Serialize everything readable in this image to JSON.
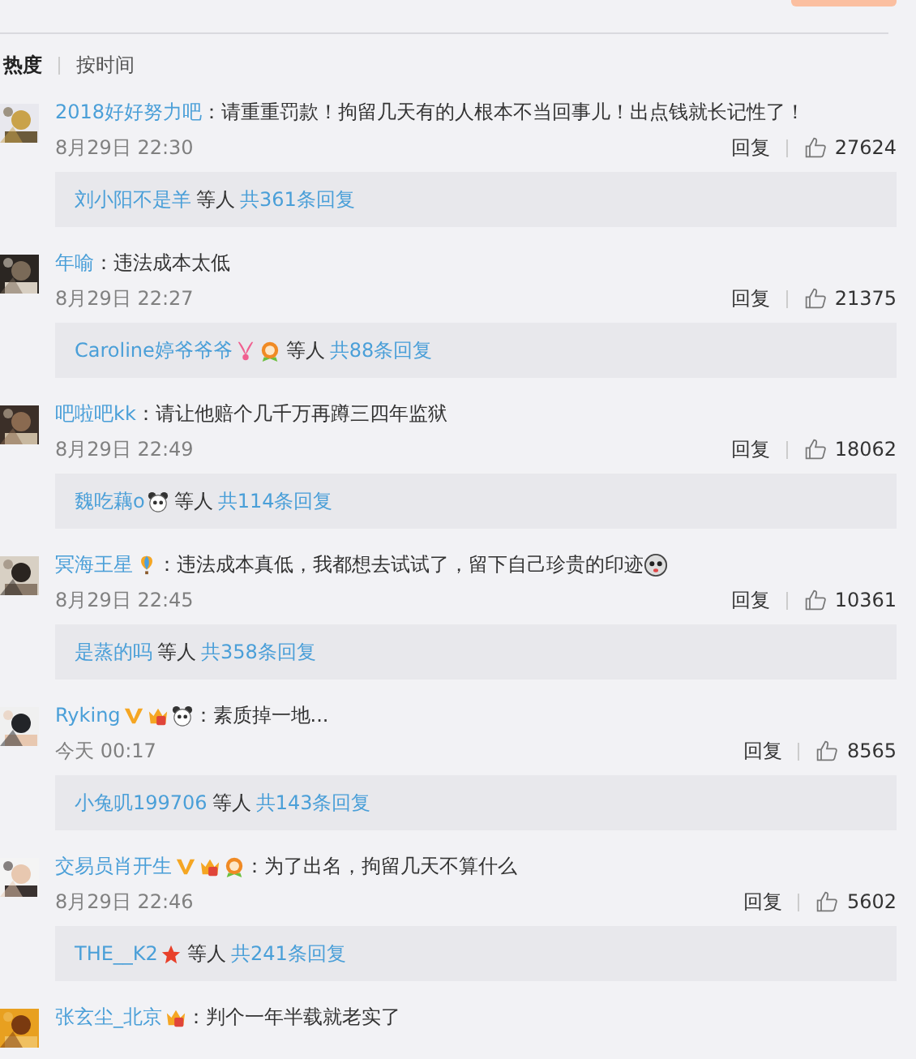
{
  "sort_tabs": [
    {
      "label": "热度",
      "selected": true
    },
    {
      "label": "按时间",
      "selected": false
    }
  ],
  "comments": [
    {
      "user": "2018好好努力吧",
      "text": "：请重重罚款！拘留几天有的人根本不当回事儿！出点钱就长记性了！",
      "time": "8月29日 22:30",
      "reply": "回复",
      "likes": "27624",
      "replies": {
        "user": "刘小阳不是羊",
        "others": "等人",
        "total": "共361条回复"
      }
    },
    {
      "user": "年喻",
      "text": "：违法成本太低",
      "time": "8月29日 22:27",
      "reply": "回复",
      "likes": "21375",
      "replies": {
        "user": "Caroline婷爷爷爷",
        "badges": [
          {
            "kind": "bunny"
          },
          {
            "kind": "medal"
          }
        ],
        "others": "等人",
        "total": "共88条回复"
      }
    },
    {
      "user": "吧啦吧kk",
      "text": "：请让他赔个几千万再蹲三四年监狱",
      "time": "8月29日 22:49",
      "reply": "回复",
      "likes": "18062",
      "replies": {
        "user": "魏吃藕o",
        "badges": [
          {
            "kind": "panda"
          }
        ],
        "others": "等人",
        "total": "共114条回复"
      }
    },
    {
      "user": "冥海王星",
      "badges": [
        {
          "kind": "balloon"
        }
      ],
      "text": "：违法成本真低，我都想去试试了，留下自己珍贵的印迹",
      "emoji": {
        "kind": "face"
      },
      "time": "8月29日 22:45",
      "reply": "回复",
      "likes": "10361",
      "replies": {
        "user": "是蒸的吗",
        "others": "等人",
        "total": "共358条回复"
      }
    },
    {
      "user": "Ryking",
      "badges": [
        {
          "kind": "verified"
        },
        {
          "kind": "crown"
        },
        {
          "kind": "panda"
        }
      ],
      "text": "：素质掉一地...",
      "time": "今天 00:17",
      "reply": "回复",
      "likes": "8565",
      "replies": {
        "user": "小兔叽199706",
        "others": "等人",
        "total": "共143条回复"
      }
    },
    {
      "user": "交易员肖开生",
      "badges": [
        {
          "kind": "verified"
        },
        {
          "kind": "crown"
        },
        {
          "kind": "medal"
        }
      ],
      "text": "：为了出名，拘留几天不算什么",
      "time": "8月29日 22:46",
      "reply": "回复",
      "likes": "5602",
      "replies": {
        "user": "THE__K2",
        "badges": [
          {
            "kind": "star"
          }
        ],
        "others": "等人",
        "total": "共241条回复"
      }
    },
    {
      "user": "张玄尘_北京",
      "badges": [
        {
          "kind": "crown"
        }
      ],
      "text": "：判个一年半载就老实了"
    }
  ]
}
